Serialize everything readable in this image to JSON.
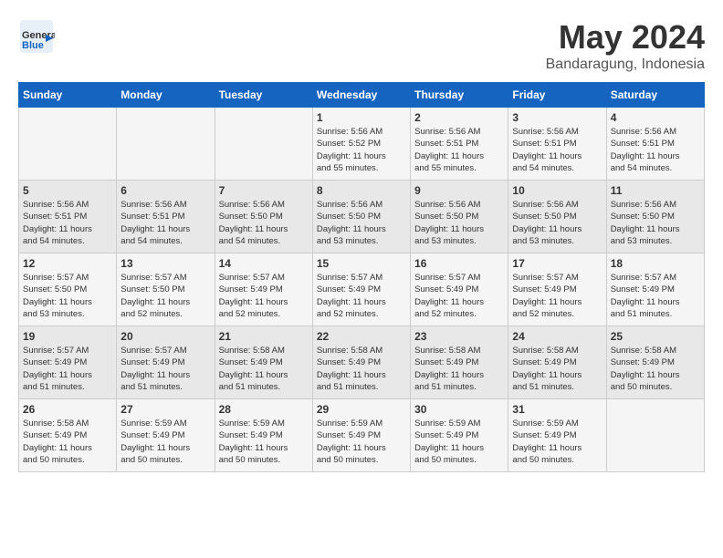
{
  "header": {
    "logo_general": "General",
    "logo_blue": "Blue",
    "month_year": "May 2024",
    "location": "Bandaragung, Indonesia"
  },
  "weekdays": [
    "Sunday",
    "Monday",
    "Tuesday",
    "Wednesday",
    "Thursday",
    "Friday",
    "Saturday"
  ],
  "weeks": [
    [
      {
        "day": "",
        "info": ""
      },
      {
        "day": "",
        "info": ""
      },
      {
        "day": "",
        "info": ""
      },
      {
        "day": "1",
        "info": "Sunrise: 5:56 AM\nSunset: 5:52 PM\nDaylight: 11 hours\nand 55 minutes."
      },
      {
        "day": "2",
        "info": "Sunrise: 5:56 AM\nSunset: 5:51 PM\nDaylight: 11 hours\nand 55 minutes."
      },
      {
        "day": "3",
        "info": "Sunrise: 5:56 AM\nSunset: 5:51 PM\nDaylight: 11 hours\nand 54 minutes."
      },
      {
        "day": "4",
        "info": "Sunrise: 5:56 AM\nSunset: 5:51 PM\nDaylight: 11 hours\nand 54 minutes."
      }
    ],
    [
      {
        "day": "5",
        "info": "Sunrise: 5:56 AM\nSunset: 5:51 PM\nDaylight: 11 hours\nand 54 minutes."
      },
      {
        "day": "6",
        "info": "Sunrise: 5:56 AM\nSunset: 5:51 PM\nDaylight: 11 hours\nand 54 minutes."
      },
      {
        "day": "7",
        "info": "Sunrise: 5:56 AM\nSunset: 5:50 PM\nDaylight: 11 hours\nand 54 minutes."
      },
      {
        "day": "8",
        "info": "Sunrise: 5:56 AM\nSunset: 5:50 PM\nDaylight: 11 hours\nand 53 minutes."
      },
      {
        "day": "9",
        "info": "Sunrise: 5:56 AM\nSunset: 5:50 PM\nDaylight: 11 hours\nand 53 minutes."
      },
      {
        "day": "10",
        "info": "Sunrise: 5:56 AM\nSunset: 5:50 PM\nDaylight: 11 hours\nand 53 minutes."
      },
      {
        "day": "11",
        "info": "Sunrise: 5:56 AM\nSunset: 5:50 PM\nDaylight: 11 hours\nand 53 minutes."
      }
    ],
    [
      {
        "day": "12",
        "info": "Sunrise: 5:57 AM\nSunset: 5:50 PM\nDaylight: 11 hours\nand 53 minutes."
      },
      {
        "day": "13",
        "info": "Sunrise: 5:57 AM\nSunset: 5:50 PM\nDaylight: 11 hours\nand 52 minutes."
      },
      {
        "day": "14",
        "info": "Sunrise: 5:57 AM\nSunset: 5:49 PM\nDaylight: 11 hours\nand 52 minutes."
      },
      {
        "day": "15",
        "info": "Sunrise: 5:57 AM\nSunset: 5:49 PM\nDaylight: 11 hours\nand 52 minutes."
      },
      {
        "day": "16",
        "info": "Sunrise: 5:57 AM\nSunset: 5:49 PM\nDaylight: 11 hours\nand 52 minutes."
      },
      {
        "day": "17",
        "info": "Sunrise: 5:57 AM\nSunset: 5:49 PM\nDaylight: 11 hours\nand 52 minutes."
      },
      {
        "day": "18",
        "info": "Sunrise: 5:57 AM\nSunset: 5:49 PM\nDaylight: 11 hours\nand 51 minutes."
      }
    ],
    [
      {
        "day": "19",
        "info": "Sunrise: 5:57 AM\nSunset: 5:49 PM\nDaylight: 11 hours\nand 51 minutes."
      },
      {
        "day": "20",
        "info": "Sunrise: 5:57 AM\nSunset: 5:49 PM\nDaylight: 11 hours\nand 51 minutes."
      },
      {
        "day": "21",
        "info": "Sunrise: 5:58 AM\nSunset: 5:49 PM\nDaylight: 11 hours\nand 51 minutes."
      },
      {
        "day": "22",
        "info": "Sunrise: 5:58 AM\nSunset: 5:49 PM\nDaylight: 11 hours\nand 51 minutes."
      },
      {
        "day": "23",
        "info": "Sunrise: 5:58 AM\nSunset: 5:49 PM\nDaylight: 11 hours\nand 51 minutes."
      },
      {
        "day": "24",
        "info": "Sunrise: 5:58 AM\nSunset: 5:49 PM\nDaylight: 11 hours\nand 51 minutes."
      },
      {
        "day": "25",
        "info": "Sunrise: 5:58 AM\nSunset: 5:49 PM\nDaylight: 11 hours\nand 50 minutes."
      }
    ],
    [
      {
        "day": "26",
        "info": "Sunrise: 5:58 AM\nSunset: 5:49 PM\nDaylight: 11 hours\nand 50 minutes."
      },
      {
        "day": "27",
        "info": "Sunrise: 5:59 AM\nSunset: 5:49 PM\nDaylight: 11 hours\nand 50 minutes."
      },
      {
        "day": "28",
        "info": "Sunrise: 5:59 AM\nSunset: 5:49 PM\nDaylight: 11 hours\nand 50 minutes."
      },
      {
        "day": "29",
        "info": "Sunrise: 5:59 AM\nSunset: 5:49 PM\nDaylight: 11 hours\nand 50 minutes."
      },
      {
        "day": "30",
        "info": "Sunrise: 5:59 AM\nSunset: 5:49 PM\nDaylight: 11 hours\nand 50 minutes."
      },
      {
        "day": "31",
        "info": "Sunrise: 5:59 AM\nSunset: 5:49 PM\nDaylight: 11 hours\nand 50 minutes."
      },
      {
        "day": "",
        "info": ""
      }
    ]
  ]
}
